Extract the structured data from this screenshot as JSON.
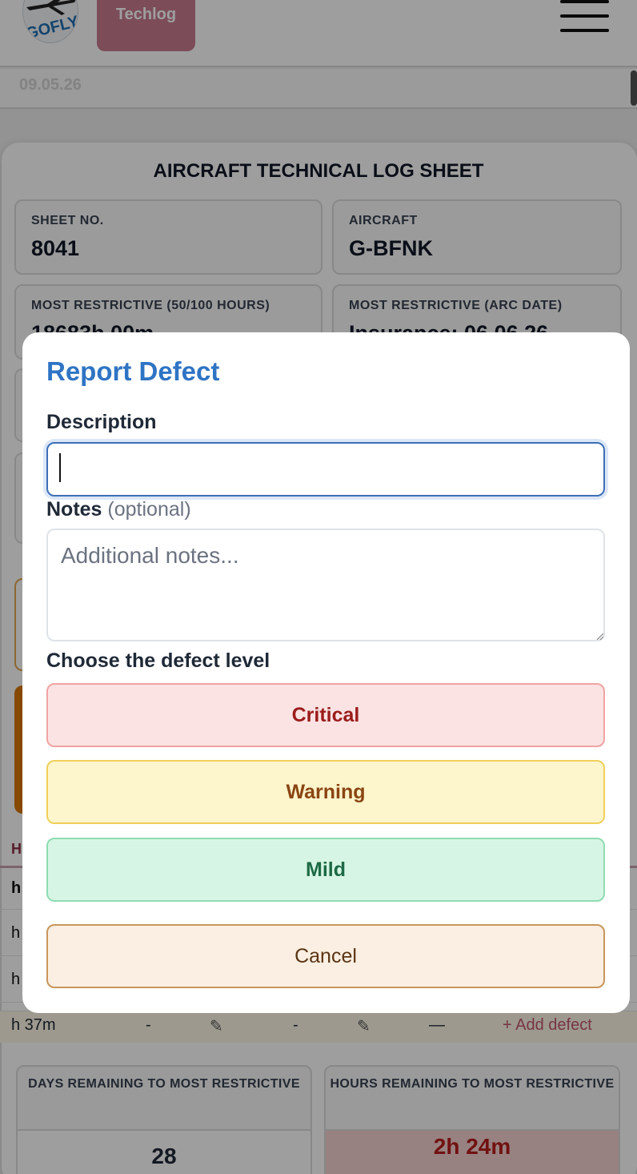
{
  "header": {
    "logo_text": "GOFLY",
    "tab_label": "Techlog",
    "menu_icon": "hamburger-menu-icon"
  },
  "date_bar": {
    "date": "09.05.26"
  },
  "sheet": {
    "title": "AIRCRAFT TECHNICAL LOG SHEET",
    "boxes": [
      {
        "label": "SHEET NO.",
        "value": "8041"
      },
      {
        "label": "AIRCRAFT",
        "value": "G-BFNK"
      },
      {
        "label": "MOST RESTRICTIVE (50/100 HOURS)",
        "value": "18683h 00m"
      },
      {
        "label": "MOST RESTRICTIVE (ARC DATE)",
        "value": "Insurance: 06.06.26"
      }
    ]
  },
  "table_peek": {
    "rows": [
      {
        "text": "H"
      },
      {
        "text": "h"
      },
      {
        "text": "h"
      },
      {
        "text": "h"
      }
    ],
    "last_row": {
      "time": "h 37m",
      "col1": "-",
      "col2": "-",
      "col3": "—",
      "add_defect": "+ Add defect"
    }
  },
  "stats": {
    "days_label": "DAYS REMAINING TO MOST RESTRICTIVE",
    "days_value": "28",
    "hours_label": "HOURS REMAINING TO MOST RESTRICTIVE",
    "hours_value": "2h 24m"
  },
  "modal": {
    "title": "Report Defect",
    "description_label": "Description",
    "description_value": "",
    "notes_label": "Notes",
    "notes_optional": "(optional)",
    "notes_placeholder": "Additional notes...",
    "level_label": "Choose the defect level",
    "levels": [
      "Critical",
      "Warning",
      "Mild"
    ],
    "cancel_label": "Cancel"
  },
  "colors": {
    "accent_blue": "#2f74c4",
    "critical_bg": "#fbe3e3",
    "warning_bg": "#fdf5cc",
    "mild_bg": "#d7f5e4",
    "cancel_bg": "#faefe2",
    "hours_alert_bg": "#f6d0d0",
    "hours_alert_text": "#b91c1c"
  }
}
